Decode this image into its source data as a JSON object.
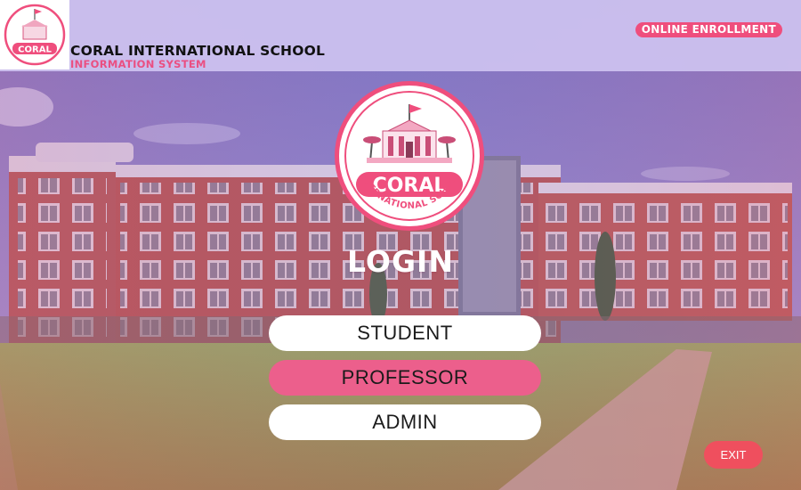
{
  "header": {
    "school_name": "CORAL INTERNATIONAL SCHOOL",
    "system_name": "INFORMATION SYSTEM",
    "enrollment_label": "ONLINE ENROLLMENT"
  },
  "logo": {
    "word": "CORAL",
    "arc_text": "INTERNATIONAL SCHOOL"
  },
  "login": {
    "title": "LOGIN",
    "roles": [
      {
        "label": "STUDENT",
        "selected": false
      },
      {
        "label": "PROFESSOR",
        "selected": true
      },
      {
        "label": "ADMIN",
        "selected": false
      }
    ]
  },
  "exit_label": "EXIT",
  "colors": {
    "accent_pink": "#ef4e7d",
    "header_lavender": "#cdc3f0",
    "selected_button": "#ec5f8c",
    "exit_button": "#ef4f5e",
    "brick": "#b35a58",
    "lawn": "#8ca05f"
  }
}
